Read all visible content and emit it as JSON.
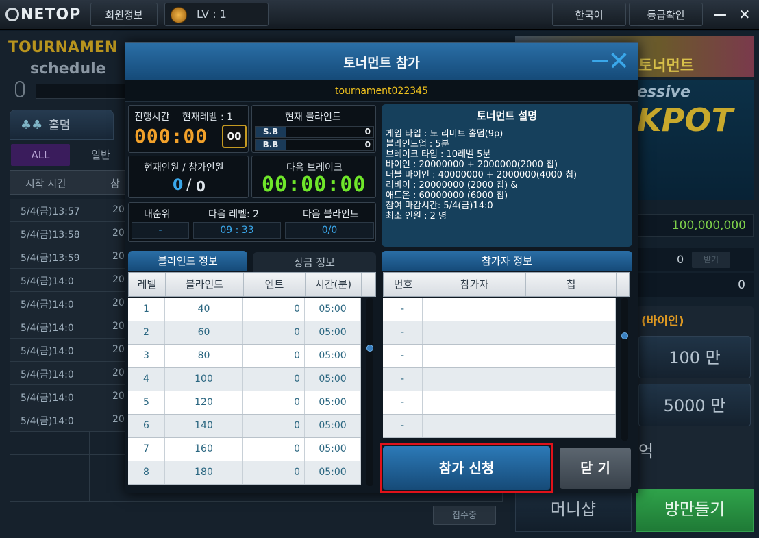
{
  "topbar": {
    "logo": "NETOP",
    "member_info": "회원정보",
    "level": "LV : 1",
    "language": "한국어",
    "grade_check": "등급확인",
    "minimize": "—",
    "close": "✕"
  },
  "background": {
    "tournament_title": "TOURNAMEN",
    "tournament_subtitle": "schedule",
    "tab_holdem": "홀덤",
    "filter_all": "ALL",
    "filter_normal": "일반",
    "list_header_start": "시작 시간",
    "list_header_partial": "참",
    "rows": [
      {
        "time": "5/4(금)13:57",
        "n": "20"
      },
      {
        "time": "5/4(금)13:58",
        "n": "20"
      },
      {
        "time": "5/4(금)13:59",
        "n": "20"
      },
      {
        "time": "5/4(금)14:0",
        "n": "20"
      },
      {
        "time": "5/4(금)14:0",
        "n": "20"
      },
      {
        "time": "5/4(금)14:0",
        "n": "20"
      },
      {
        "time": "5/4(금)14:0",
        "n": "20"
      },
      {
        "time": "5/4(금)14:0",
        "n": "20"
      },
      {
        "time": "5/4(금)14:0",
        "n": "20"
      },
      {
        "time": "5/4(금)14:0",
        "n": "20"
      }
    ],
    "reception": "접수중",
    "jackpot_banner": "토너먼트",
    "jackpot_sub": "essive",
    "jackpot_big": "KPOT",
    "money_total": "100,000,000",
    "money_zero": "0",
    "receive": "받기",
    "money_zero2": "0",
    "buyin_label": "(바이인)",
    "amount_1": "100 만",
    "amount_2": "5000 만",
    "amount_3": "억",
    "money_shop": "머니샵",
    "make_room": "방만들기"
  },
  "modal": {
    "title": "토너먼트 참가",
    "tournament_id": "tournament022345",
    "progress_time_label": "진행시간",
    "current_level_label": "현재레벨 : 1",
    "progress_time": "000:00",
    "progress_seconds": "00",
    "current_blind_label": "현재 블라인드",
    "sb_label": "S.B",
    "sb_value": "0",
    "bb_label": "B.B",
    "bb_value": "0",
    "players_label": "현재인원 / 참가인원",
    "players_current": "0",
    "players_sep": "/",
    "players_total": "0",
    "next_break_label": "다음 브레이크",
    "next_break": "00:00:00",
    "my_rank_label": "내순위",
    "my_rank": "-",
    "next_level_label": "다음 레벨: 2",
    "next_level_time": "09 : 33",
    "next_blind_label": "다음 블라인드",
    "next_blind": "0/0",
    "desc_title": "토너먼트 설명",
    "desc_lines": [
      "게임 타입 : 노 리미트 홀덤(9p)",
      "블라인드업 : 5분",
      "브레이크 타입 : 10레벨 5분",
      "바이인 : 20000000 + 2000000(2000 칩)",
      "더블 바이인 : 40000000 + 2000000(4000 칩)",
      "리바이 : 20000000 (2000 칩) &",
      "애드온 : 60000000 (6000 칩)",
      "참여 마감시간: 5/4(금)14:0",
      "최소 인원 : 2 명"
    ],
    "tab_blind_info": "블라인드 정보",
    "tab_prize_info": "상금 정보",
    "blind_headers": [
      "레벨",
      "블라인드",
      "엔트",
      "시간(분)"
    ],
    "blind_rows": [
      {
        "level": "1",
        "blind": "40",
        "ante": "0",
        "time": "05:00"
      },
      {
        "level": "2",
        "blind": "60",
        "ante": "0",
        "time": "05:00"
      },
      {
        "level": "3",
        "blind": "80",
        "ante": "0",
        "time": "05:00"
      },
      {
        "level": "4",
        "blind": "100",
        "ante": "0",
        "time": "05:00"
      },
      {
        "level": "5",
        "blind": "120",
        "ante": "0",
        "time": "05:00"
      },
      {
        "level": "6",
        "blind": "140",
        "ante": "0",
        "time": "05:00"
      },
      {
        "level": "7",
        "blind": "160",
        "ante": "0",
        "time": "05:00"
      },
      {
        "level": "8",
        "blind": "180",
        "ante": "0",
        "time": "05:00"
      }
    ],
    "participant_title": "참가자 정보",
    "participant_headers": [
      "번호",
      "참가자",
      "칩"
    ],
    "participant_rows": [
      {
        "no": "-",
        "name": "",
        "chip": ""
      },
      {
        "no": "-",
        "name": "",
        "chip": ""
      },
      {
        "no": "-",
        "name": "",
        "chip": ""
      },
      {
        "no": "-",
        "name": "",
        "chip": ""
      },
      {
        "no": "-",
        "name": "",
        "chip": ""
      },
      {
        "no": "-",
        "name": "",
        "chip": ""
      }
    ],
    "apply_button": "참가 신청",
    "close_button": "닫 기"
  },
  "colors": {
    "accent_blue": "#3aa7ea",
    "timer_orange": "#f2a12a",
    "timer_green": "#6fe62a",
    "highlight_red": "#e0121a"
  }
}
